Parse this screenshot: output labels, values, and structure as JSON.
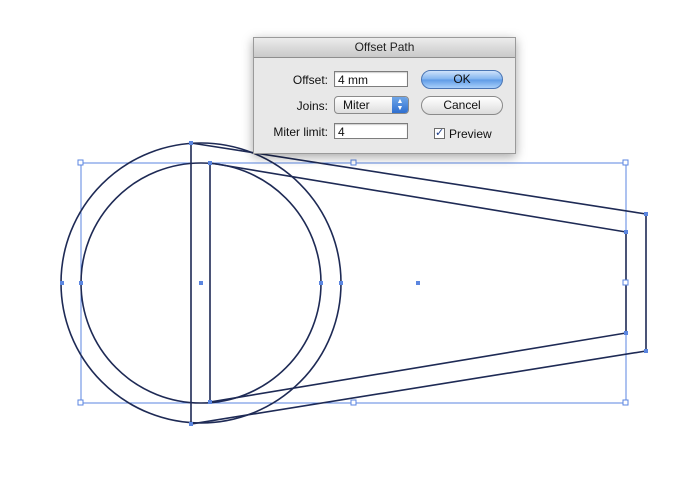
{
  "dialog": {
    "title": "Offset Path",
    "offset": {
      "label": "Offset:",
      "value": "4 mm"
    },
    "joins": {
      "label": "Joins:",
      "value": "Miter"
    },
    "miter_limit": {
      "label": "Miter limit:",
      "value": "4"
    },
    "ok_label": "OK",
    "cancel_label": "Cancel",
    "preview": {
      "label": "Preview",
      "checked": true
    }
  },
  "icons": {
    "check": "check-icon",
    "select_arrows": "up-down-arrows-icon"
  },
  "colors": {
    "path_stroke": "#1e2a55",
    "selection": "#5b86e0"
  }
}
